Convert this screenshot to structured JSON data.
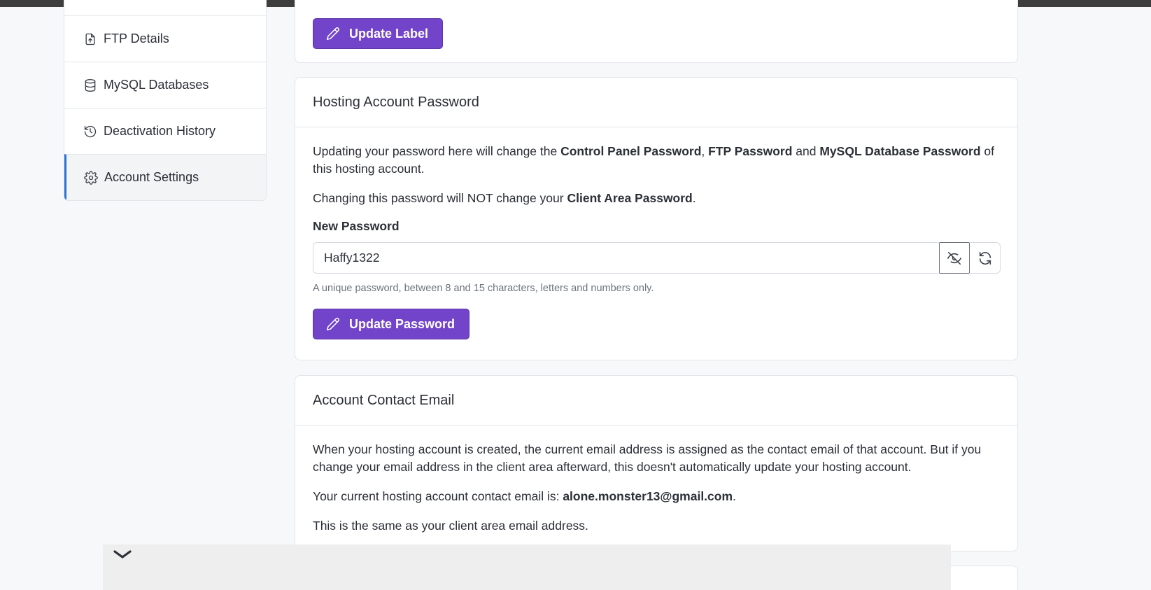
{
  "sidebar": {
    "items": [
      {
        "label": "",
        "icon": "none"
      },
      {
        "label": "FTP Details",
        "icon": "file-upload-icon"
      },
      {
        "label": "MySQL Databases",
        "icon": "database-icon"
      },
      {
        "label": "Deactivation History",
        "icon": "history-icon"
      },
      {
        "label": "Account Settings",
        "icon": "gear-icon",
        "active": true
      }
    ]
  },
  "label_card": {
    "button_label": "Update Label"
  },
  "password_card": {
    "title": "Hosting Account Password",
    "intro": {
      "t1": "Updating your password here will change the ",
      "b1": "Control Panel Password",
      "t2": ", ",
      "b2": "FTP Password",
      "t3": " and ",
      "b3": "MySQL Database Password",
      "t4": " of this hosting account."
    },
    "note": {
      "t1": "Changing this password will NOT change your ",
      "b1": "Client Area Password",
      "t2": "."
    },
    "field_label": "New Password",
    "field_value": "Haffy1322",
    "hint": "A unique password, between 8 and 15 characters, letters and numbers only.",
    "button_label": "Update Password"
  },
  "email_card": {
    "title": "Account Contact Email",
    "para1": "When your hosting account is created, the current email address is assigned as the contact email of that account. But if you change your email address in the client area afterward, this doesn't automatically update your hosting account.",
    "current": {
      "t1": "Your current hosting account contact email is: ",
      "email": "alone.monster13@gmail.com",
      "t2": "."
    },
    "para3": "This is the same as your client area email address."
  },
  "colors": {
    "accent": "#7244c9",
    "active_border": "#2a72d5"
  }
}
